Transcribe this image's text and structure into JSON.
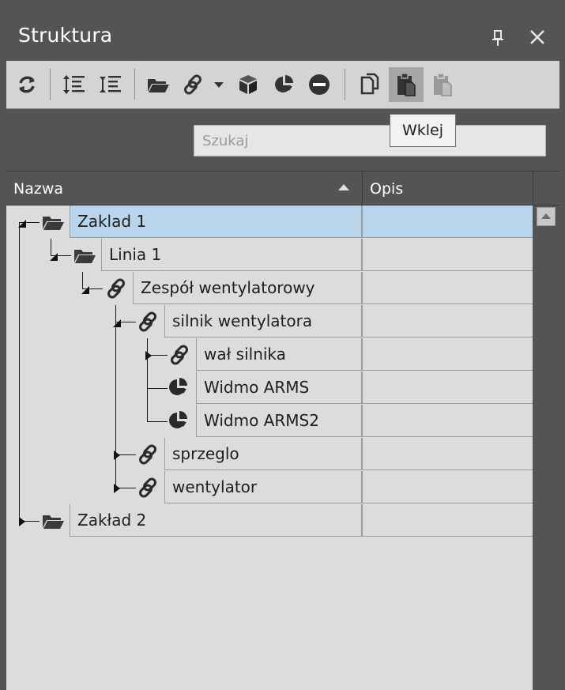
{
  "window": {
    "title": "Struktura"
  },
  "toolbar": {
    "tooltip": "Wklej",
    "buttons": [
      {
        "icon": "refresh-icon"
      },
      {
        "icon": "expand-all-icon"
      },
      {
        "icon": "collapse-all-icon"
      },
      {
        "icon": "folder-icon"
      },
      {
        "icon": "link-icon"
      },
      {
        "icon": "dropdown-arrow-icon"
      },
      {
        "icon": "cube-icon"
      },
      {
        "icon": "pie-chart-icon"
      },
      {
        "icon": "remove-icon"
      },
      {
        "icon": "copy-icon"
      },
      {
        "icon": "paste-icon"
      },
      {
        "icon": "paste-special-icon"
      }
    ]
  },
  "search": {
    "placeholder": "Szukaj",
    "value": ""
  },
  "columns": [
    {
      "label": "Nazwa"
    },
    {
      "label": "Opis"
    }
  ],
  "tree": [
    {
      "label": "Zaklad 1",
      "icon": "folder",
      "level": 0,
      "expanded": true,
      "selected": true
    },
    {
      "label": "Linia 1",
      "icon": "folder",
      "level": 1,
      "expanded": true,
      "selected": false
    },
    {
      "label": "Zespół wentylatorowy",
      "icon": "link",
      "level": 2,
      "expanded": true,
      "selected": false
    },
    {
      "label": "silnik wentylatora",
      "icon": "link",
      "level": 3,
      "expanded": true,
      "selected": false
    },
    {
      "label": "wał silnika",
      "icon": "link",
      "level": 4,
      "expanded": false,
      "selected": false
    },
    {
      "label": "Widmo ARMS",
      "icon": "pie",
      "level": 4,
      "expanded": null,
      "selected": false
    },
    {
      "label": "Widmo ARMS2",
      "icon": "pie",
      "level": 4,
      "expanded": null,
      "selected": false
    },
    {
      "label": "sprzeglo",
      "icon": "link",
      "level": 3,
      "expanded": false,
      "selected": false
    },
    {
      "label": "wentylator",
      "icon": "link",
      "level": 3,
      "expanded": false,
      "selected": false
    },
    {
      "label": "Zakład 2",
      "icon": "folder",
      "level": 0,
      "expanded": false,
      "selected": false
    }
  ]
}
